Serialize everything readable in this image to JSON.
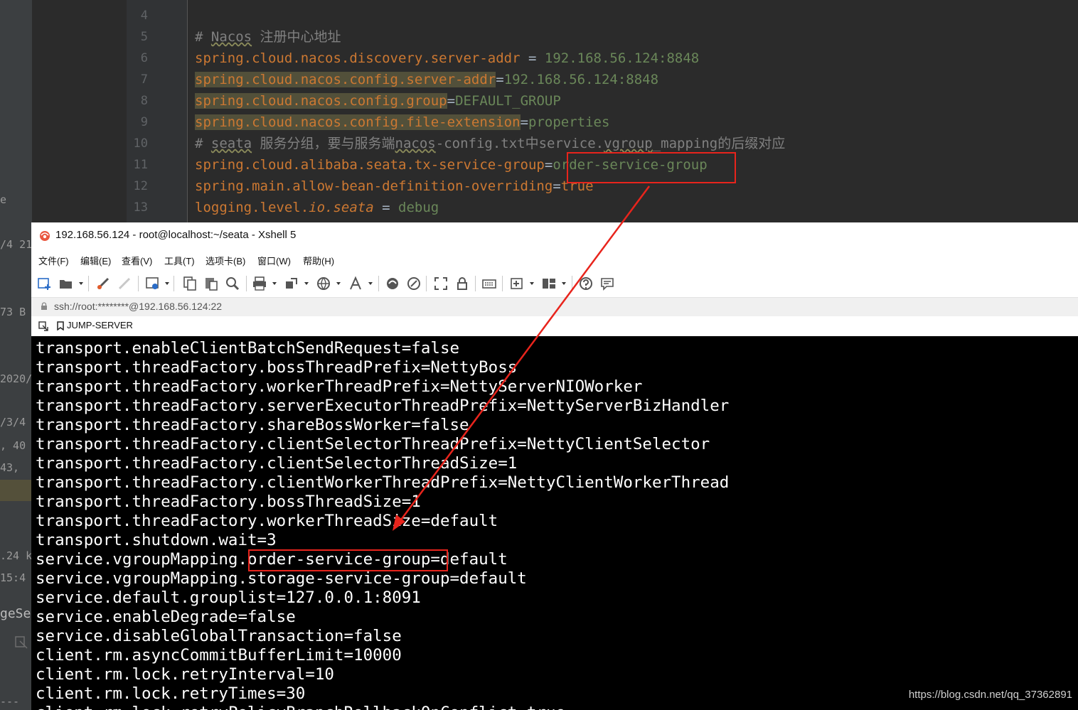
{
  "ide": {
    "left_fragments": [
      "e",
      "/4 21",
      "73 B",
      "2020/",
      "/3/4",
      ", 40",
      "43,",
      ".24 k",
      "15:4",
      "geSe",
      "---"
    ],
    "line_numbers": [
      "4",
      "5",
      "6",
      "7",
      "8",
      "9",
      "10",
      "11",
      "12",
      "13"
    ],
    "lines": [
      {
        "segments": []
      },
      {
        "segments": [
          {
            "t": "# ",
            "c": "c"
          },
          {
            "t": "Nacos",
            "c": "c wv"
          },
          {
            "t": " 注册中心地址",
            "c": "c"
          }
        ]
      },
      {
        "segments": [
          {
            "t": "spring.cloud.nacos.discovery.server-addr",
            "c": "k"
          },
          {
            "t": " = ",
            "c": "p"
          },
          {
            "t": "192.168.56.124:8848",
            "c": "v"
          }
        ]
      },
      {
        "segments": [
          {
            "t": "spring.cloud.nacos.config.server-addr",
            "c": "k hl"
          },
          {
            "t": "=",
            "c": "p"
          },
          {
            "t": "192.168.56.124:8848",
            "c": "v"
          }
        ]
      },
      {
        "segments": [
          {
            "t": "spring.cloud.nacos.config.group",
            "c": "k hl"
          },
          {
            "t": "=",
            "c": "p"
          },
          {
            "t": "DEFAULT_GROUP",
            "c": "v"
          }
        ]
      },
      {
        "segments": [
          {
            "t": "spring.cloud.nacos.config.file-extension",
            "c": "k hl"
          },
          {
            "t": "=",
            "c": "p"
          },
          {
            "t": "properties",
            "c": "v"
          }
        ]
      },
      {
        "segments": [
          {
            "t": "# ",
            "c": "c"
          },
          {
            "t": "seata",
            "c": "c wv"
          },
          {
            "t": " 服务分组，要与服务端",
            "c": "c"
          },
          {
            "t": "nacos",
            "c": "c wv"
          },
          {
            "t": "-config.txt中service.",
            "c": "c"
          },
          {
            "t": "vgroup",
            "c": "c wv"
          },
          {
            "t": "_mapping的后缀对应",
            "c": "c"
          }
        ]
      },
      {
        "segments": [
          {
            "t": "spring.cloud.alibaba.seata.tx-service-group",
            "c": "k"
          },
          {
            "t": "=",
            "c": "p"
          },
          {
            "t": "order-service-group",
            "c": "v"
          }
        ]
      },
      {
        "segments": [
          {
            "t": "spring.main.allow-bean-definition-overriding",
            "c": "k"
          },
          {
            "t": "=",
            "c": "p"
          },
          {
            "t": "true",
            "c": "k"
          }
        ]
      },
      {
        "segments": [
          {
            "t": "logging.level.",
            "c": "k"
          },
          {
            "t": "io.seata",
            "c": "k it"
          },
          {
            "t": " = ",
            "c": "p"
          },
          {
            "t": "debug",
            "c": "v"
          }
        ]
      }
    ]
  },
  "xshell": {
    "title": "192.168.56.124 - root@localhost:~/seata - Xshell 5",
    "menu": [
      "文件(F)",
      "编辑(E)",
      "查看(V)",
      "工具(T)",
      "选项卡(B)",
      "窗口(W)",
      "帮助(H)"
    ],
    "address": "ssh://root:********@192.168.56.124:22",
    "session_tab": "JUMP-SERVER",
    "terminal_lines": [
      "transport.enableClientBatchSendRequest=false",
      "transport.threadFactory.bossThreadPrefix=NettyBoss",
      "transport.threadFactory.workerThreadPrefix=NettyServerNIOWorker",
      "transport.threadFactory.serverExecutorThreadPrefix=NettyServerBizHandler",
      "transport.threadFactory.shareBossWorker=false",
      "transport.threadFactory.clientSelectorThreadPrefix=NettyClientSelector",
      "transport.threadFactory.clientSelectorThreadSize=1",
      "transport.threadFactory.clientWorkerThreadPrefix=NettyClientWorkerThread",
      "transport.threadFactory.bossThreadSize=1",
      "transport.threadFactory.workerThreadSize=default",
      "transport.shutdown.wait=3",
      "service.vgroupMapping.order-service-group=default",
      "service.vgroupMapping.storage-service-group=default",
      "service.default.grouplist=127.0.0.1:8091",
      "service.enableDegrade=false",
      "service.disableGlobalTransaction=false",
      "client.rm.asyncCommitBufferLimit=10000",
      "client.rm.lock.retryInterval=10",
      "client.rm.lock.retryTimes=30",
      "client.rm.lock.retryPolicyBranchRollbackOnConflict=true"
    ]
  },
  "watermark": "https://blog.csdn.net/qq_37362891",
  "colors": {
    "annotation_red": "#e8241c",
    "terminal_bg": "#000000",
    "ide_bg": "#2b2b2b"
  }
}
